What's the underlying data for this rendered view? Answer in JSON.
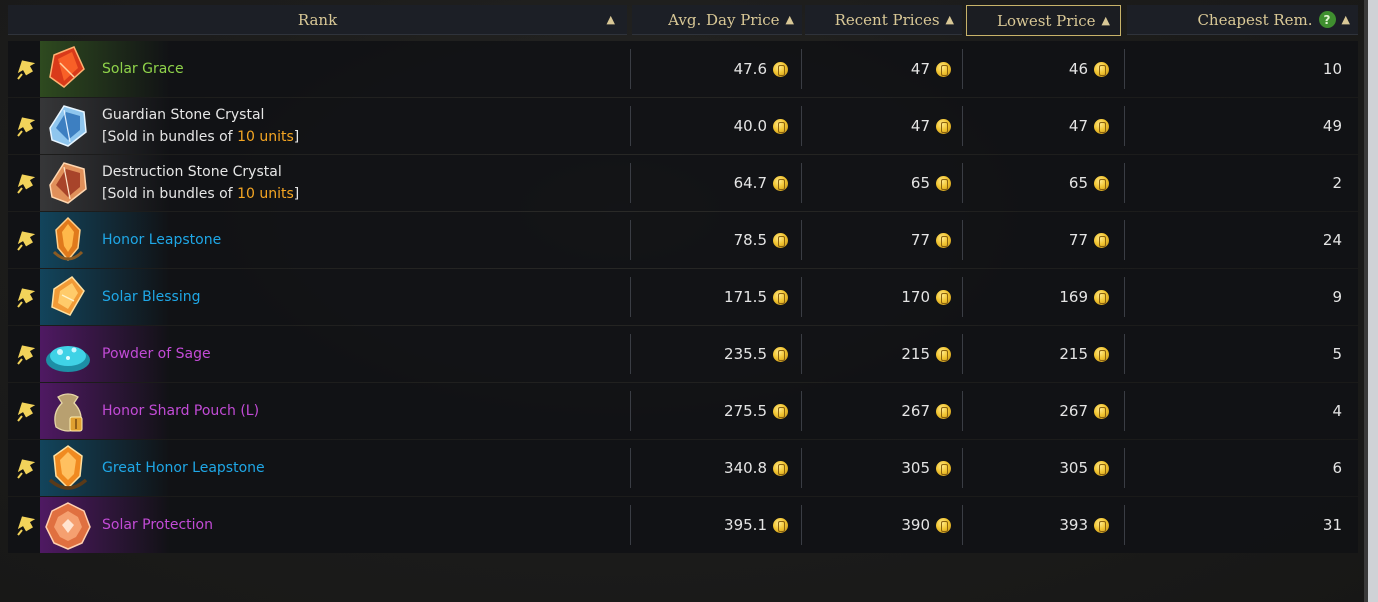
{
  "header": {
    "rank": "Rank",
    "avg_day_price": "Avg. Day Price",
    "recent_prices": "Recent Prices",
    "lowest_price": "Lowest Price",
    "cheapest_rem": "Cheapest Rem.",
    "sort_glyph": "▲",
    "help_glyph": "?"
  },
  "colors": {
    "green": "#8fd34a",
    "blue": "#1fa7e6",
    "purple": "#c24bd6",
    "white": "#e6e6e6",
    "accent_gold": "#d9c896"
  },
  "rows": [
    {
      "name": "Solar Grace",
      "line2_prefix": "",
      "line2_highlight": "",
      "line2_suffix": "",
      "avg": "47.6",
      "recent": "47",
      "lowest": "46",
      "rem": "10",
      "rarity": "green",
      "icon": "red-crystal-icon"
    },
    {
      "name": "Guardian Stone Crystal",
      "line2_prefix": "[Sold in bundles of ",
      "line2_highlight": "10 units",
      "line2_suffix": "]",
      "avg": "40.0",
      "recent": "47",
      "lowest": "47",
      "rem": "49",
      "rarity": "white",
      "icon": "blue-crystal-icon"
    },
    {
      "name": "Destruction Stone Crystal",
      "line2_prefix": "[Sold in bundles of ",
      "line2_highlight": "10 units",
      "line2_suffix": "]",
      "avg": "64.7",
      "recent": "65",
      "lowest": "65",
      "rem": "2",
      "rarity": "white",
      "icon": "orange-crystal-icon"
    },
    {
      "name": "Honor Leapstone",
      "line2_prefix": "",
      "line2_highlight": "",
      "line2_suffix": "",
      "avg": "78.5",
      "recent": "77",
      "lowest": "77",
      "rem": "24",
      "rarity": "blue",
      "icon": "leapstone-icon"
    },
    {
      "name": "Solar Blessing",
      "line2_prefix": "",
      "line2_highlight": "",
      "line2_suffix": "",
      "avg": "171.5",
      "recent": "170",
      "lowest": "169",
      "rem": "9",
      "rarity": "blue",
      "icon": "solar-blessing-icon"
    },
    {
      "name": "Powder of Sage",
      "line2_prefix": "",
      "line2_highlight": "",
      "line2_suffix": "",
      "avg": "235.5",
      "recent": "215",
      "lowest": "215",
      "rem": "5",
      "rarity": "purple",
      "icon": "powder-icon"
    },
    {
      "name": "Honor Shard Pouch (L)",
      "line2_prefix": "",
      "line2_highlight": "",
      "line2_suffix": "",
      "avg": "275.5",
      "recent": "267",
      "lowest": "267",
      "rem": "4",
      "rarity": "purple",
      "icon": "pouch-icon"
    },
    {
      "name": "Great Honor Leapstone",
      "line2_prefix": "",
      "line2_highlight": "",
      "line2_suffix": "",
      "avg": "340.8",
      "recent": "305",
      "lowest": "305",
      "rem": "6",
      "rarity": "blue",
      "icon": "great-leapstone-icon"
    },
    {
      "name": "Solar Protection",
      "line2_prefix": "",
      "line2_highlight": "",
      "line2_suffix": "",
      "avg": "395.1",
      "recent": "390",
      "lowest": "393",
      "rem": "31",
      "rarity": "purple",
      "icon": "solar-protection-icon"
    }
  ]
}
